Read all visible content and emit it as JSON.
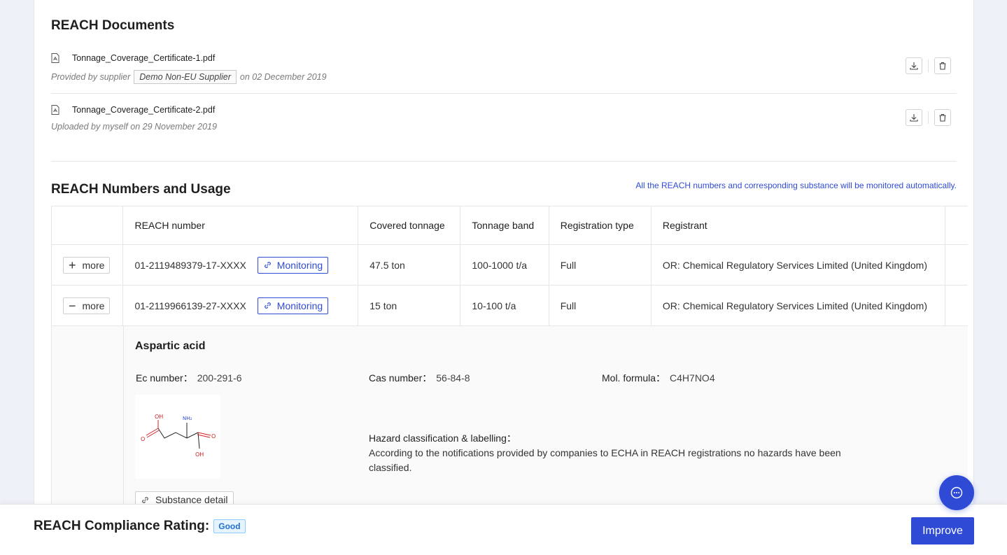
{
  "documents": {
    "title": "REACH Documents",
    "items": [
      {
        "name": "Tonnage_Coverage_Certificate-1.pdf",
        "meta_prefix": "Provided by supplier",
        "supplier": "Demo Non-EU Supplier",
        "meta_suffix": "on 02 December 2019"
      },
      {
        "name": "Tonnage_Coverage_Certificate-2.pdf",
        "meta_prefix": "Uploaded by myself on 29 November 2019"
      }
    ],
    "icons": {
      "file": "pdf-file-icon",
      "download": "download-icon",
      "delete": "trash-icon"
    }
  },
  "usage": {
    "title": "REACH Numbers and Usage",
    "notice": "All the REACH numbers and corresponding substance will be monitored automatically.",
    "columns": [
      "REACH number",
      "Covered tonnage",
      "Tonnage band",
      "Registration type",
      "Registrant"
    ],
    "rows": [
      {
        "toggle_symbol": "+",
        "toggle_label": "more",
        "reach_number": "01-2119489379-17-XXXX",
        "monitor_label": "Monitoring",
        "covered_tonnage": "47.5 ton",
        "tonnage_band": "100-1000 t/a",
        "registration_type": "Full",
        "registrant": "OR: Chemical Regulatory Services Limited (United Kingdom)"
      },
      {
        "toggle_symbol": "−",
        "toggle_label": "more",
        "reach_number": "01-2119966139-27-XXXX",
        "monitor_label": "Monitoring",
        "covered_tonnage": "15 ton",
        "tonnage_band": "10-100 t/a",
        "registration_type": "Full",
        "registrant": "OR: Chemical Regulatory Services Limited (United Kingdom)"
      }
    ],
    "expanded": {
      "substance": "Aspartic acid",
      "ec_label": "Ec number：",
      "ec_value": "200-291-6",
      "cas_label": "Cas number：",
      "cas_value": "56-84-8",
      "mol_label": "Mol. formula：",
      "mol_value": "C4H7NO4",
      "hazard_title": "Hazard classification & labelling：",
      "hazard_text": "According to the notifications provided by companies to ECHA in REACH registrations no hazards have been classified.",
      "detail_button": "Substance detail",
      "structure_labels": {
        "oh_top": "OH",
        "nh2": "NH₂",
        "o_left": "O",
        "o_right": "O",
        "oh_bottom": "OH"
      }
    }
  },
  "footer": {
    "title": "REACH Compliance Rating:",
    "rating": "Good",
    "improve_button": "Improve"
  },
  "colors": {
    "accent": "#2f4bd6",
    "badge_text": "#1f6fd1",
    "molecule_red": "#d62020"
  }
}
